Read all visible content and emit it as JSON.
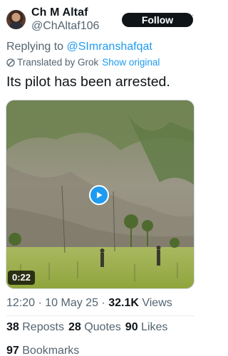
{
  "author": {
    "name": "Ch M Altaf",
    "handle": "@ChAltaf106"
  },
  "follow_label": "Follow",
  "reply": {
    "prefix": "Replying to ",
    "to": "@SImranshafqat"
  },
  "translation": {
    "label": "Translated by Grok",
    "show_original": "Show original"
  },
  "tweet_text": "Its pilot has been arrested.",
  "video": {
    "duration": "0:22"
  },
  "meta": {
    "time": "12:20",
    "date": "10 May 25",
    "views_count": "32.1K",
    "views_label": "Views"
  },
  "stats": {
    "reposts_count": "38",
    "reposts_label": "Reposts",
    "quotes_count": "28",
    "quotes_label": "Quotes",
    "likes_count": "90",
    "likes_label": "Likes",
    "bookmarks_count": "97",
    "bookmarks_label": "Bookmarks"
  },
  "colors": {
    "accent": "#1d9bf0",
    "text": "#0f1419",
    "secondary": "#536471"
  }
}
